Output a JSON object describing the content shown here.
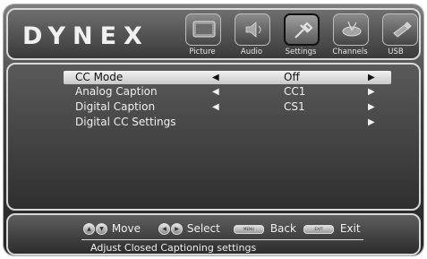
{
  "brand": {
    "logo": "DYNEX"
  },
  "menu": [
    {
      "label": "Picture",
      "icon": "picture-icon",
      "active": false
    },
    {
      "label": "Audio",
      "icon": "audio-icon",
      "active": false
    },
    {
      "label": "Settings",
      "icon": "settings-icon",
      "active": true
    },
    {
      "label": "Channels",
      "icon": "channels-icon",
      "active": false
    },
    {
      "label": "USB",
      "icon": "usb-icon",
      "active": false
    }
  ],
  "settings": {
    "rows": [
      {
        "label": "CC Mode",
        "value": "Off",
        "left_arrow": "◀",
        "right_arrow": "▶",
        "selected": true
      },
      {
        "label": "Analog Caption",
        "value": "CC1",
        "left_arrow": "◀",
        "right_arrow": "▶",
        "selected": false
      },
      {
        "label": "Digital Caption",
        "value": "CS1",
        "left_arrow": "◀",
        "right_arrow": "▶",
        "selected": false
      },
      {
        "label": "Digital CC Settings",
        "value": "",
        "left_arrow": "",
        "right_arrow": "▶",
        "selected": false
      }
    ]
  },
  "footer": {
    "move": "Move",
    "select": "Select",
    "back": "Back",
    "exit": "Exit",
    "menu_key": "MENU",
    "exit_key": "EXIT",
    "description": "Adjust Closed Captioning settings"
  },
  "colors": {
    "selected_row": "#e6e6e6",
    "panel": "#3a3a3a",
    "text": "#f0f0f0"
  }
}
